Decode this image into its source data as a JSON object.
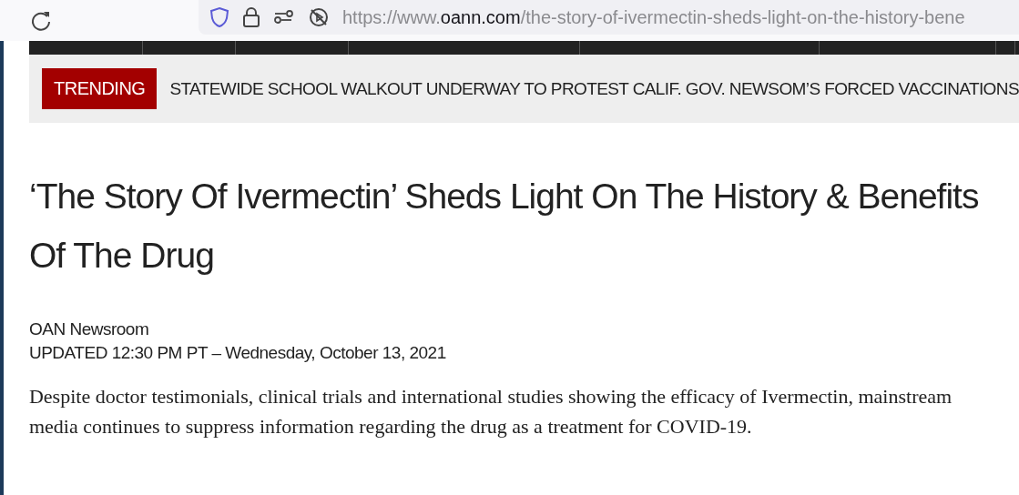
{
  "browser": {
    "url": {
      "prefix": "https://www.",
      "domain": "oann.com",
      "path": "/the-story-of-ivermectin-sheds-light-on-the-history-bene"
    }
  },
  "trending": {
    "label": "TRENDING",
    "headline": "STATEWIDE SCHOOL WALKOUT UNDERWAY TO PROTEST CALIF. GOV. NEWSOM’S FORCED VACCINATIONS"
  },
  "article": {
    "title": "‘The Story Of Ivermectin’ Sheds Light On The History & Benefits Of The Drug",
    "author": "OAN Newsroom",
    "updated": "UPDATED 12:30 PM PT – Wednesday, October 13, 2021",
    "lead": "Despite doctor testimonials, clinical trials and international studies showing the efficacy of Ivermectin, mainstream media continues to suppress information regarding the drug as a treatment for COVID-19."
  }
}
